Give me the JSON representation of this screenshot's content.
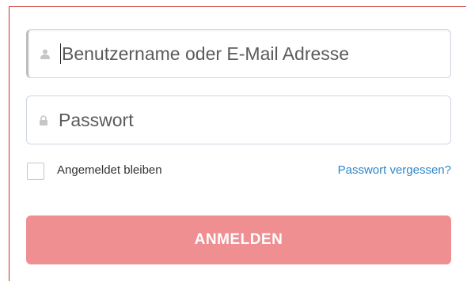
{
  "login_form": {
    "username_placeholder": "Benutzername oder E-Mail Adresse",
    "password_placeholder": "Passwort",
    "remember_label": "Angemeldet bleiben",
    "remember_checked": false,
    "forgot_password_label": "Passwort vergessen?",
    "submit_label": "ANMELDEN"
  },
  "icons": {
    "username_icon": "user-icon",
    "password_icon": "lock-icon"
  },
  "colors": {
    "button_bg": "#ef8f92",
    "link": "#2f86c8",
    "panel_border": "#c9302c"
  }
}
